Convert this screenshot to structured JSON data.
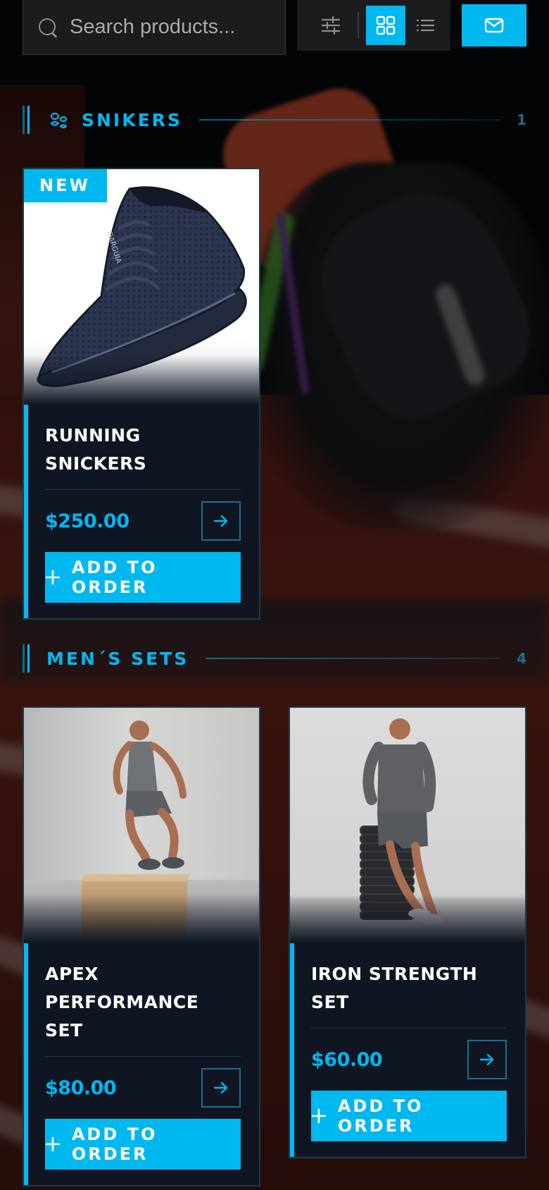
{
  "search": {
    "placeholder": "Search products..."
  },
  "toolbar": {
    "filter_icon": "sliders-icon",
    "grid_icon": "grid-icon",
    "list_icon": "list-icon",
    "mail_icon": "mail-icon",
    "active_view": "grid"
  },
  "colors": {
    "accent": "#00b8f0",
    "card_bg": "#0f1622",
    "border": "#1d3a4c"
  },
  "sections": [
    {
      "title": "SNIKERS",
      "count": "1",
      "icon": "footprints-icon",
      "products": [
        {
          "badge": "NEW",
          "name": "RUNNING SNICKERS",
          "price": "$250.00",
          "button": "ADD TO ORDER"
        }
      ]
    },
    {
      "title": "MEN´S SETS",
      "count": "4",
      "products": [
        {
          "name": "APEX PERFORMANCE SET",
          "price": "$80.00",
          "button": "ADD TO ORDER"
        },
        {
          "name": "IRON STRENGTH SET",
          "price": "$60.00",
          "button": "ADD TO ORDER"
        }
      ]
    }
  ]
}
